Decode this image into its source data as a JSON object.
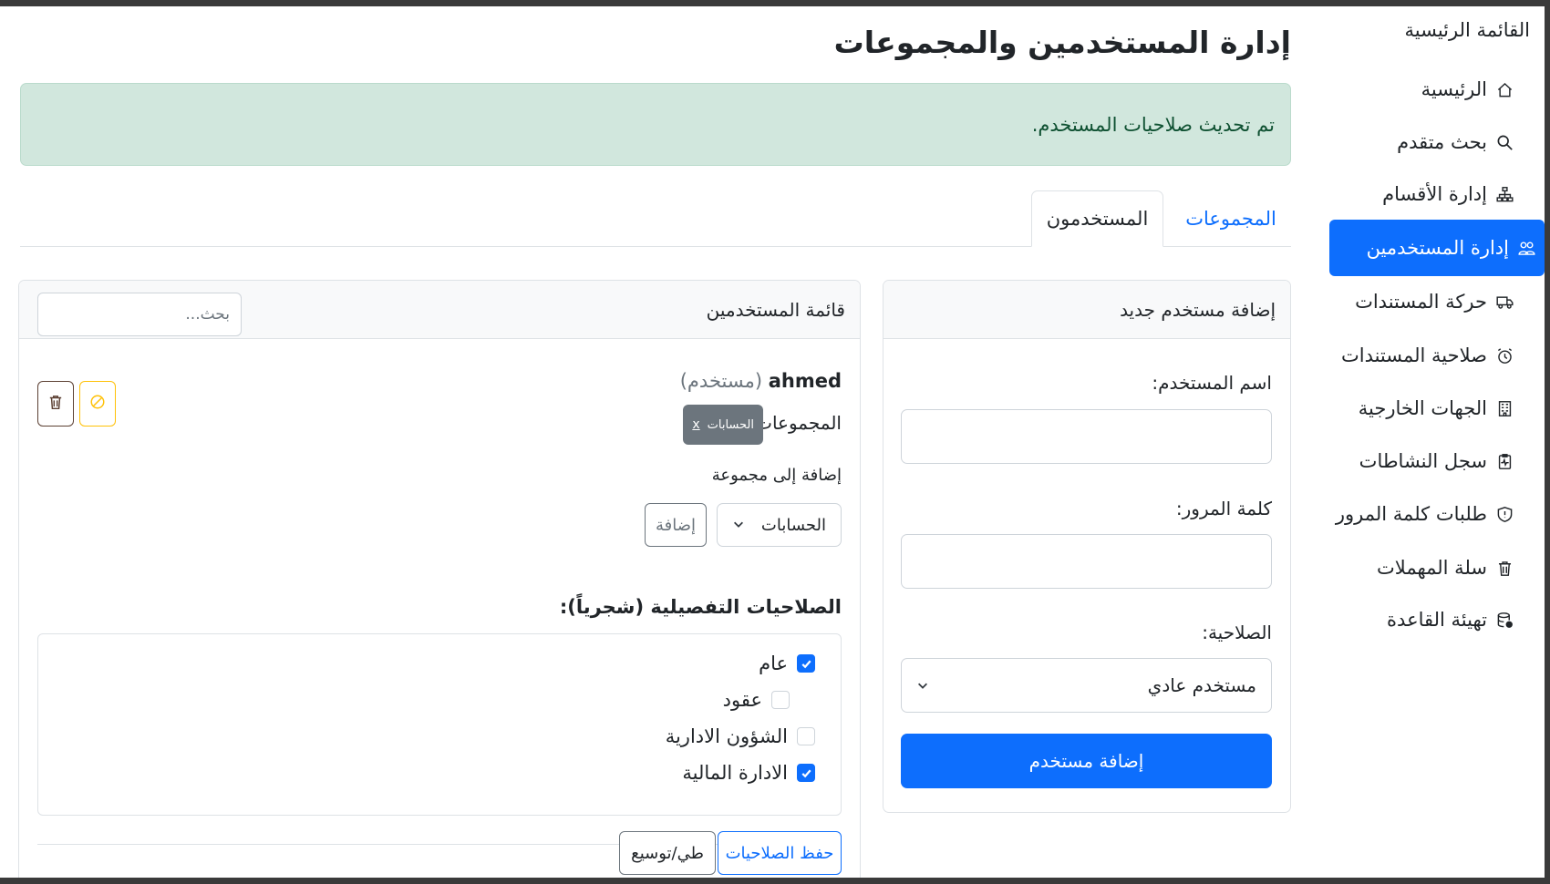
{
  "sidebar": {
    "heading": "القائمة الرئيسية",
    "items": [
      {
        "label": "الرئيسية",
        "icon": "house-icon",
        "active": false
      },
      {
        "label": "بحث متقدم",
        "icon": "search-icon",
        "active": false
      },
      {
        "label": "إدارة الأقسام",
        "icon": "diagram-icon",
        "active": false
      },
      {
        "label": "إدارة المستخدمين",
        "icon": "people-icon",
        "active": true
      },
      {
        "label": "حركة المستندات",
        "icon": "truck-icon",
        "active": false
      },
      {
        "label": "صلاحية المستندات",
        "icon": "alarm-icon",
        "active": false
      },
      {
        "label": "الجهات الخارجية",
        "icon": "building-icon",
        "active": false
      },
      {
        "label": "سجل النشاطات",
        "icon": "clipboard-pulse-icon",
        "active": false
      },
      {
        "label": "طلبات كلمة المرور",
        "icon": "shield-icon",
        "active": false
      },
      {
        "label": "سلة المهملات",
        "icon": "trash-icon",
        "active": false
      },
      {
        "label": "تهيئة القاعدة",
        "icon": "database-gear-icon",
        "active": false
      }
    ]
  },
  "page": {
    "title": "إدارة المستخدمين والمجموعات",
    "alert": "تم تحديث صلاحيات المستخدم."
  },
  "tabs": {
    "users": "المستخدمون",
    "groups": "المجموعات"
  },
  "add_user": {
    "header": "إضافة مستخدم جديد",
    "username_label": "اسم المستخدم:",
    "password_label": "كلمة المرور:",
    "role_label": "الصلاحية:",
    "role_value": "مستخدم عادي",
    "submit": "إضافة مستخدم"
  },
  "users_list": {
    "header": "قائمة المستخدمين",
    "search_placeholder": "بحث...",
    "user": {
      "name": "ahmed",
      "role": "(مستخدم)",
      "groups_label": "المجموعات:",
      "group_badge": "الحسابات",
      "group_remove": "x",
      "add_to_group_label": "إضافة إلى مجموعة",
      "group_select_value": "الحسابات",
      "add_button": "إضافة"
    },
    "permissions_title": "الصلاحيات التفصيلية (شجرياً):",
    "permissions": [
      {
        "label": "عام",
        "checked": true
      },
      {
        "label": "عقود",
        "checked": false
      },
      {
        "label": "الشؤون الادارية",
        "checked": false
      },
      {
        "label": "الادارة المالية",
        "checked": true
      }
    ],
    "save_button": "حفظ الصلاحيات",
    "toggle_button": "طي/توسيع"
  },
  "colors": {
    "primary": "#0d6efd",
    "alert_bg": "#d1e7dd",
    "alert_text": "#0f5132",
    "warning": "#ffc107",
    "secondary": "#6c757d"
  }
}
